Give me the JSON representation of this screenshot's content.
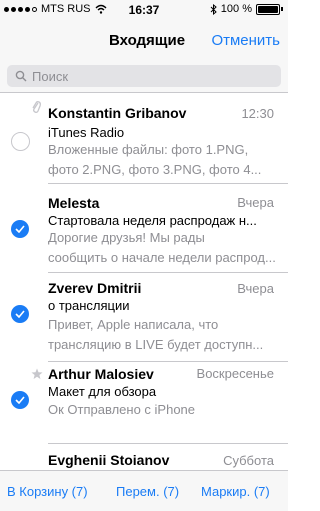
{
  "status": {
    "carrier": "MTS RUS",
    "time": "16:37",
    "battery_text": "100 %",
    "battery_level": 1.0
  },
  "nav": {
    "title": "Входящие",
    "cancel_label": "Отменить"
  },
  "search": {
    "placeholder": "Поиск"
  },
  "mails": [
    {
      "sender": "Konstantin Gribanov",
      "date": "12:30",
      "subject": "iTunes Radio",
      "preview_lines": [
        "Вложенные файлы: фото 1.PNG,",
        "фото 2.PNG, фото 3.PNG, фото 4..."
      ],
      "selected": false,
      "attachment_icon": "paperclip-icon"
    },
    {
      "sender": "Melesta",
      "date": "Вчера",
      "subject": "Стартовала неделя распродаж н...",
      "preview_lines": [
        "Дорогие друзья! Мы рады",
        "сообщить о начале недели распрод..."
      ],
      "selected": true
    },
    {
      "sender": "Zverev Dmitrii",
      "date": "Вчера",
      "subject": "о трансляции",
      "preview_lines": [
        "Привет, Apple написала, что",
        "трансляцию в LIVE будет доступн..."
      ],
      "selected": true
    },
    {
      "sender": "Arthur Malosiev",
      "date": "Воскресенье",
      "subject": "Макет для обзора",
      "preview_lines": [
        "Ок Отправлено с iPhone"
      ],
      "selected": true,
      "flag_icon": "star-icon"
    },
    {
      "sender": "Evghenii Stoianov",
      "date": "Суббота"
    }
  ],
  "toolbar": {
    "trash_label": "В Корзину (7)",
    "move_label": "Перем. (7)",
    "mark_label": "Маркир. (7)"
  },
  "colors": {
    "accent": "#1a7cf5",
    "secondary_text": "#8e8e93"
  }
}
